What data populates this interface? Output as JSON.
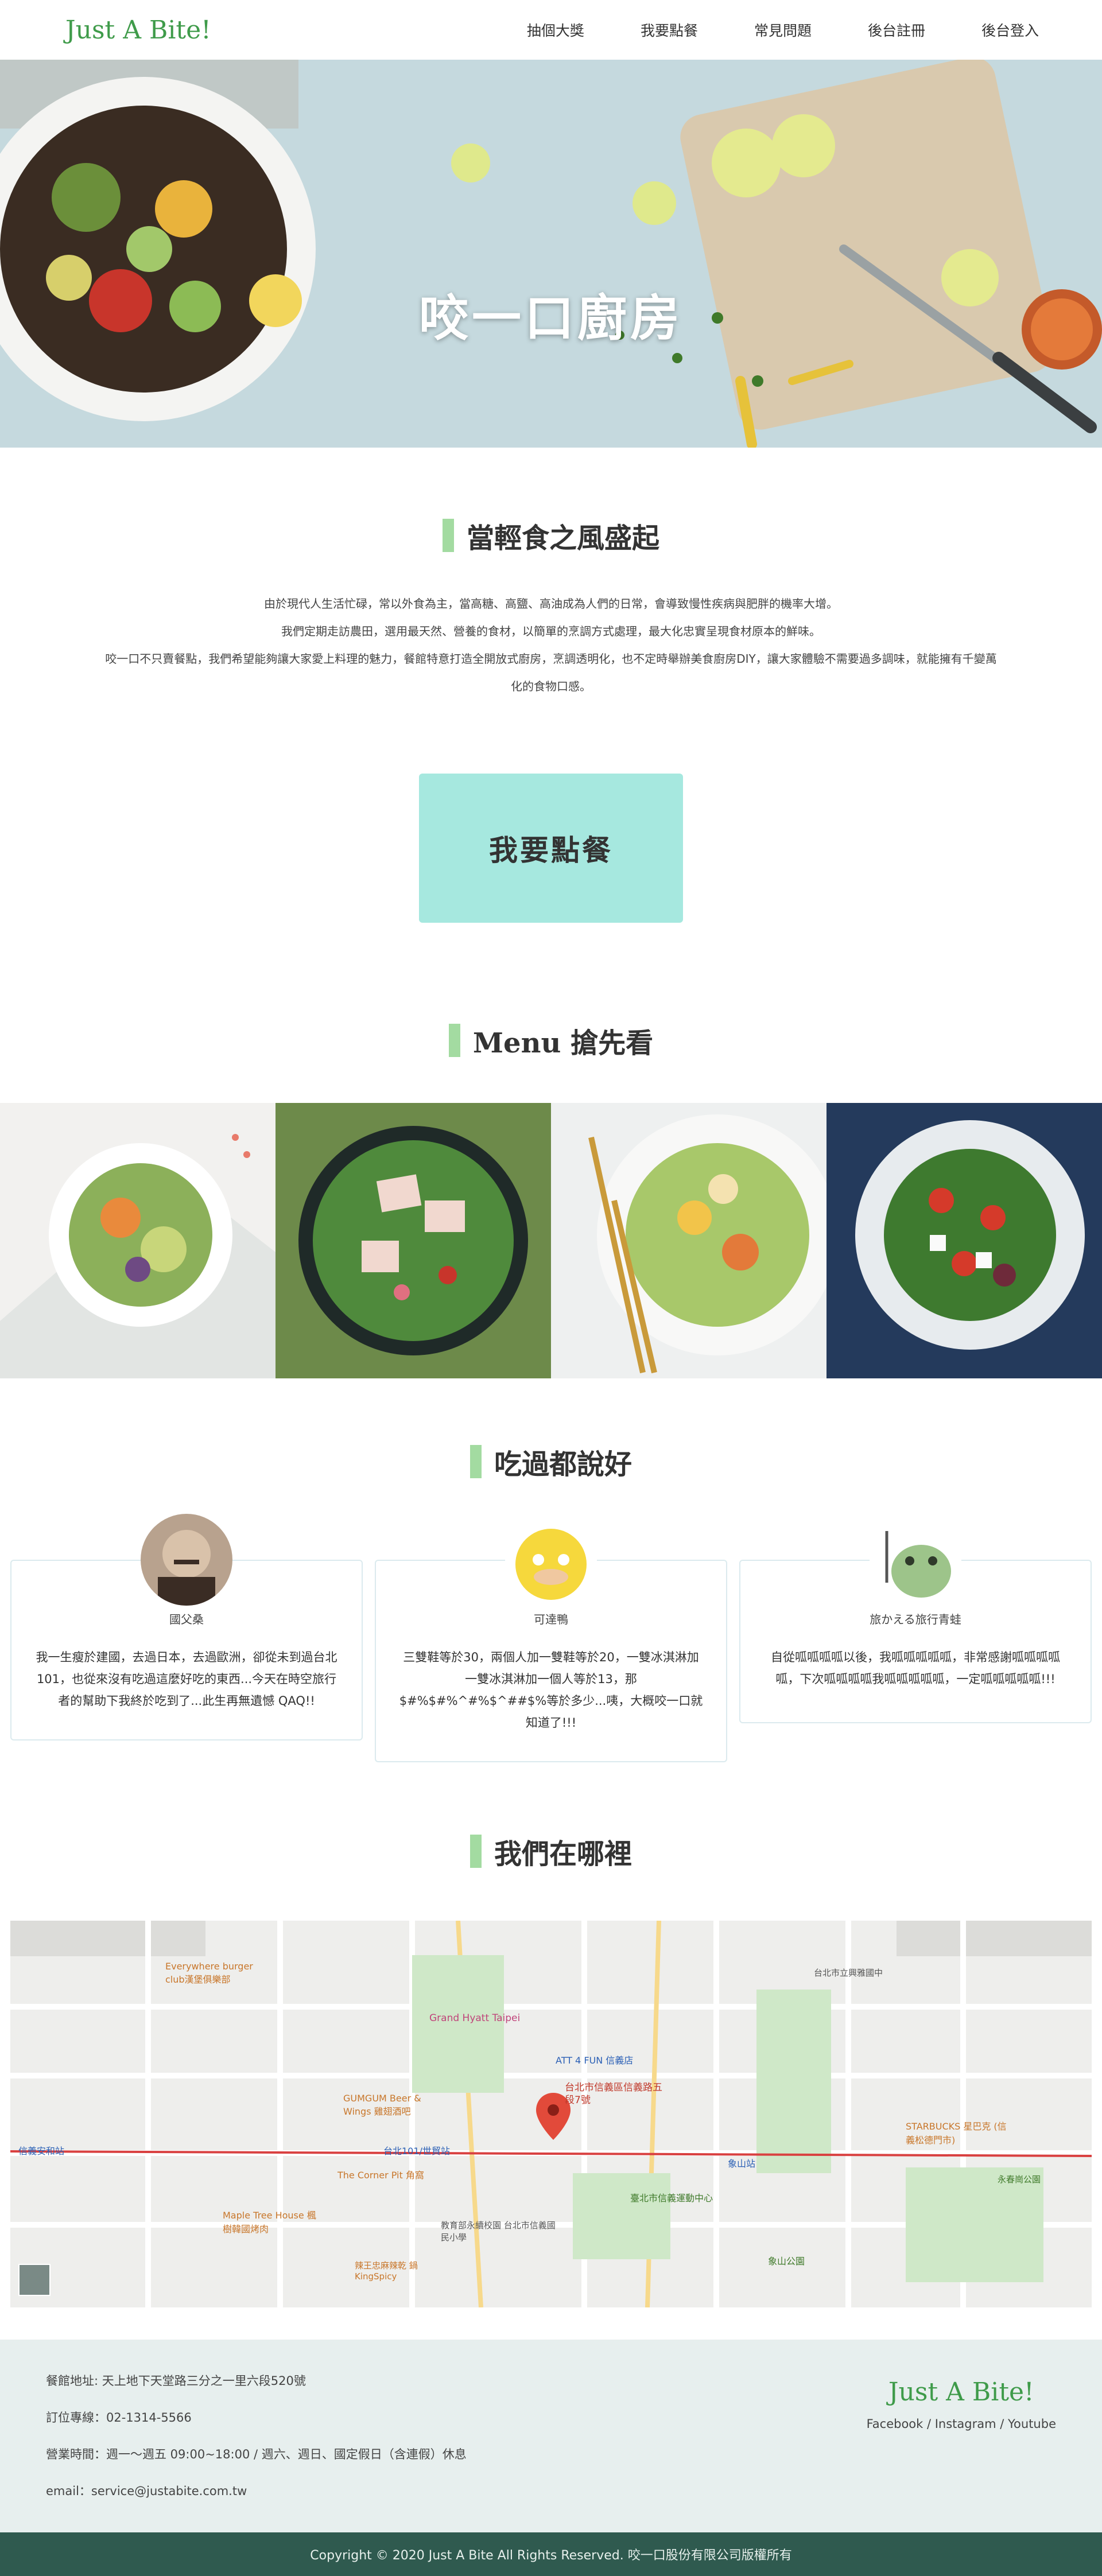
{
  "nav": {
    "brand": "Just A Bite!",
    "links": [
      "抽個大獎",
      "我要點餐",
      "常見問題",
      "後台註冊",
      "後台登入"
    ]
  },
  "hero": {
    "title": "咬一口廚房"
  },
  "intro": {
    "title": "當輕食之風盛起",
    "lines": [
      "由於現代人生活忙碌，常以外食為主，當高糖、高鹽、高油成為人們的日常，會導致慢性疾病與肥胖的機率大增。",
      "我們定期走訪農田，選用最天然、營養的食材，以簡單的烹調方式處理，最大化忠實呈現食材原本的鮮味。",
      "咬一口不只賣餐點，我們希望能夠讓大家愛上料理的魅力，餐館特意打造全開放式廚房，烹調透明化，也不定時舉辦美食廚房DIY，讓大家體驗不需要過多調味，就能擁有千變萬",
      "化的食物口感。"
    ],
    "cta": "我要點餐"
  },
  "menu": {
    "title_latin": "Menu",
    "title_cjk": "搶先看"
  },
  "reviews": {
    "title": "吃過都說好",
    "items": [
      {
        "name": "國父桑",
        "text": "我一生瘦於建國，去過日本，去過歐洲，卻從未到過台北101，也從來沒有吃過這麼好吃的東西...今天在時空旅行者的幫助下我終於吃到了...此生再無遺憾 QAQ!!"
      },
      {
        "name": "可達鴨",
        "text": "三雙鞋等於30，兩個人加一雙鞋等於20，一雙冰淇淋加一雙冰淇淋加一個人等於13，那$#%$#%^#%$^##$%等於多少...咦，大概咬一口就知道了!!!"
      },
      {
        "name": "旅かえる旅行青蛙",
        "text": "自從呱呱呱呱以後，我呱呱呱呱呱，非常感謝呱呱呱呱呱，下次呱呱呱呱我呱呱呱呱呱，一定呱呱呱呱呱!!!"
      }
    ]
  },
  "location": {
    "title": "我們在哪裡",
    "map_labels": [
      "台北市信義區信義路五段7號",
      "台北101/世貿站",
      "信義安和站",
      "象山站",
      "Grand Hyatt Taipei",
      "ATT 4 FUN 信義店",
      "Everywhere burger club漢堡俱樂部",
      "The Corner Pit 角窩",
      "Maple Tree House 楓樹韓國烤肉",
      "GUMGUM Beer & Wings 雞翅酒吧",
      "STARBUCKS 星巴克 (信義松德門市)",
      "象山公園",
      "臺北市信義運動中心",
      "教育部永續校園 台北市信義國民小學",
      "台北市立興雅國中",
      "永春崗公園",
      "辣王忠麻辣乾 鍋KingSpicy"
    ]
  },
  "footer": {
    "address": "餐館地址: 天上地下天堂路三分之一里六段520號",
    "phone": "訂位專線：02-1314-5566",
    "hours": "營業時間：週一～週五 09:00~18:00 / 週六、週日、國定假日（含連假）休息",
    "email": "email：service@justabite.com.tw",
    "brand": "Just A Bite!",
    "social": "Facebook / Instagram / Youtube"
  },
  "copyright": "Copyright © 2020 Just A Bite All Rights Reserved. 咬一口股份有限公司版權所有",
  "colors": {
    "brand_green": "#3f9b4a",
    "accent_bar": "#a3dba1",
    "cta_bg": "#a6e8df",
    "footer_bg": "#e7efee",
    "copyright_bg": "#2f5a4f"
  }
}
